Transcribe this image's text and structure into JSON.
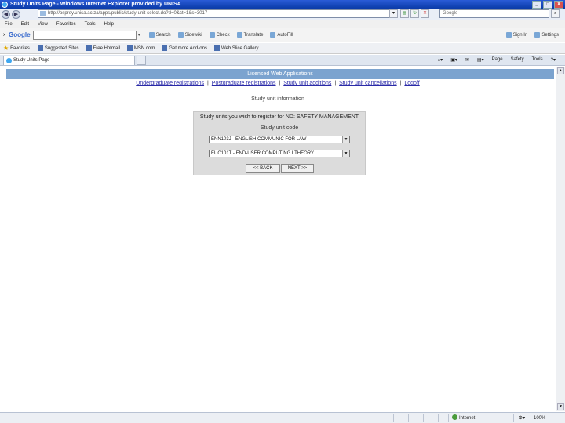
{
  "window": {
    "title": "Study Units Page - Windows Internet Explorer provided by UNISA",
    "minimize": "_",
    "maximize": "□",
    "close": "X"
  },
  "address": {
    "url": "http://osprey.unisa.ac.za/apps/public/study-unit-select.do?d=0&ct=1&s=3017",
    "search_placeholder": "Google"
  },
  "menu": [
    "File",
    "Edit",
    "View",
    "Favorites",
    "Tools",
    "Help"
  ],
  "googlebar": {
    "close": "x",
    "logo": "Google",
    "search": "Search",
    "items_left": [
      "Sidewiki",
      "Check",
      "Translate",
      "AutoFill"
    ],
    "items_right": [
      "Sign In",
      "Settings"
    ]
  },
  "favorites": {
    "label": "Favorites",
    "items": [
      "Suggested Sites",
      "Free Hotmail",
      "MSN.com",
      "Get more Add-ons",
      "Web Slice Gallery"
    ]
  },
  "tab": {
    "title": "Study Units Page",
    "tools": [
      "Page",
      "Safety",
      "Tools"
    ]
  },
  "page": {
    "band_title": "Licensed Web Applications",
    "nav": [
      "Undergraduate registrations",
      "Postgraduate registrations",
      "Study unit additions",
      "Study unit cancellations",
      "Logoff"
    ],
    "nav_sep": "|",
    "section_title": "Study unit information",
    "panel_heading": "Study units you wish to register for ND: SAFETY MANAGEMENT",
    "study_unit_label": "Study unit code",
    "select1_value": "ENN103J - ENGLISH COMMUNIC FOR LAW",
    "select2_value": "EUC101T - END-USER COMPUTING I THEORY",
    "back_label": "<< BACK",
    "next_label": "NEXT >>"
  },
  "status": {
    "zone": "Internet",
    "zoom": "100%"
  }
}
